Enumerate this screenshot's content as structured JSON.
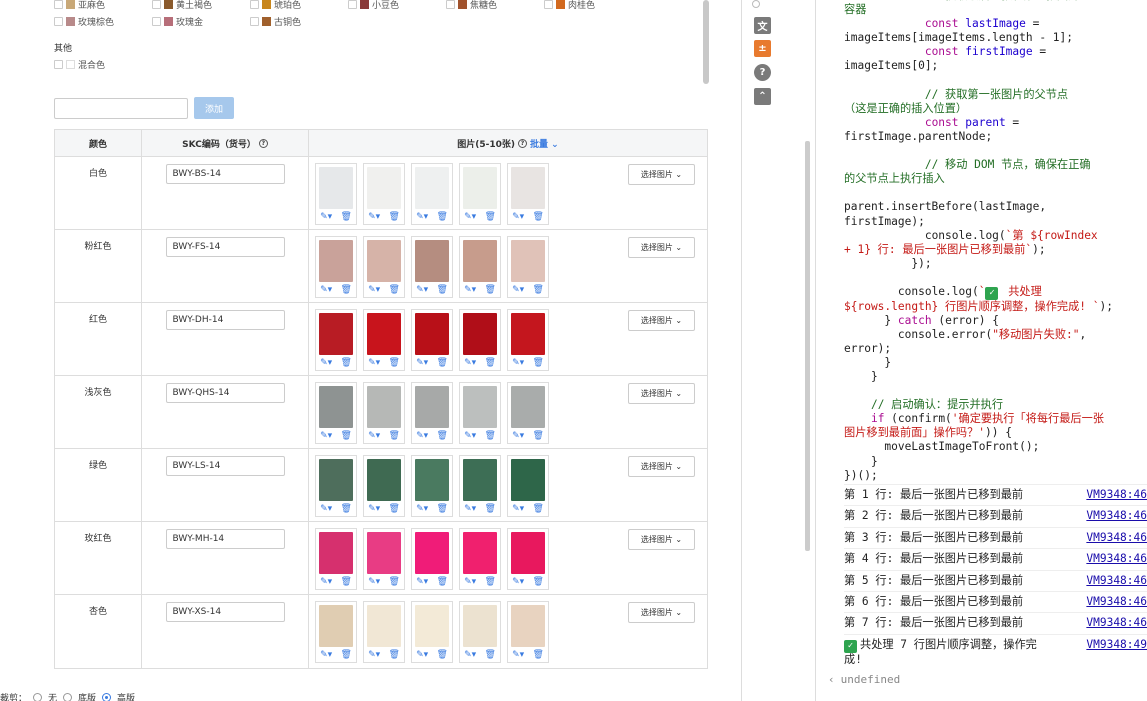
{
  "colors_rows": [
    [
      {
        "label": "亚麻色",
        "swatch": "#c8a878"
      },
      {
        "label": "黄土褐色",
        "swatch": "#8a5a2c"
      },
      {
        "label": "琥珀色",
        "swatch": "#c8861c"
      },
      {
        "label": "小豆色",
        "swatch": "#8a3a3a"
      },
      {
        "label": "焦糖色",
        "swatch": "#a0522d"
      },
      {
        "label": "肉桂色",
        "swatch": "#d2691e"
      }
    ],
    [
      {
        "label": "玫瑰棕色",
        "swatch": "#b88a8a"
      },
      {
        "label": "玫瑰金",
        "swatch": "#b76e79"
      },
      {
        "label": "古铜色",
        "swatch": "#a0602c"
      }
    ]
  ],
  "other_label": "其他",
  "mixed_label": "混合色",
  "add_button": "添加",
  "table": {
    "col_color": "颜色",
    "col_skc": "SKC编码（货号）",
    "col_images": "图片(5-10张)",
    "batch": "批量",
    "select_btn": "选择图片",
    "rows": [
      {
        "color": "白色",
        "skc": "BWY-BS-14",
        "pics": [
          "#e6e8ea",
          "#f0f0ee",
          "#eef0f0",
          "#ecefea",
          "#e8e4e2"
        ]
      },
      {
        "color": "粉红色",
        "skc": "BWY-FS-14",
        "pics": [
          "#c9a29a",
          "#d6b3a8",
          "#b58d80",
          "#c79c8c",
          "#e0c2b8"
        ]
      },
      {
        "color": "红色",
        "skc": "BWY-DH-14",
        "pics": [
          "#b81c24",
          "#c8141c",
          "#b81018",
          "#b00e18",
          "#c4161e"
        ]
      },
      {
        "color": "浅灰色",
        "skc": "BWY-QHS-14",
        "pics": [
          "#8e9392",
          "#b6b8b6",
          "#a7a9a8",
          "#bcbfbe",
          "#a9acab"
        ]
      },
      {
        "color": "绿色",
        "skc": "BWY-LS-14",
        "pics": [
          "#4e6e5c",
          "#3f6a52",
          "#4a7a60",
          "#3d6e55",
          "#2e6649"
        ]
      },
      {
        "color": "玫红色",
        "skc": "BWY-MH-14",
        "pics": [
          "#d6306e",
          "#e83c84",
          "#f01c78",
          "#f0206e",
          "#e8185e"
        ]
      },
      {
        "color": "杏色",
        "skc": "BWY-XS-14",
        "pics": [
          "#e0cdb2",
          "#f1e7d5",
          "#f3ead7",
          "#ece2d0",
          "#e8d3c0"
        ]
      }
    ]
  },
  "cut_label": "裁剪：",
  "radio_opts": [
    "无",
    "底版",
    "高版"
  ],
  "console": {
    "log_lines": [
      "第 1 行: 最后一张图片已移到最前",
      "第 2 行: 最后一张图片已移到最前",
      "第 3 行: 最后一张图片已移到最前",
      "第 4 行: 最后一张图片已移到最前",
      "第 5 行: 最后一张图片已移到最前",
      "第 6 行: 最后一张图片已移到最前",
      "第 7 行: 最后一张图片已移到最前"
    ],
    "log_src": "VM9348:46",
    "final_msg": "共处理 7 行图片顺序调整，操作完成!",
    "final_src": "VM9348:49",
    "undefined": "undefined"
  }
}
